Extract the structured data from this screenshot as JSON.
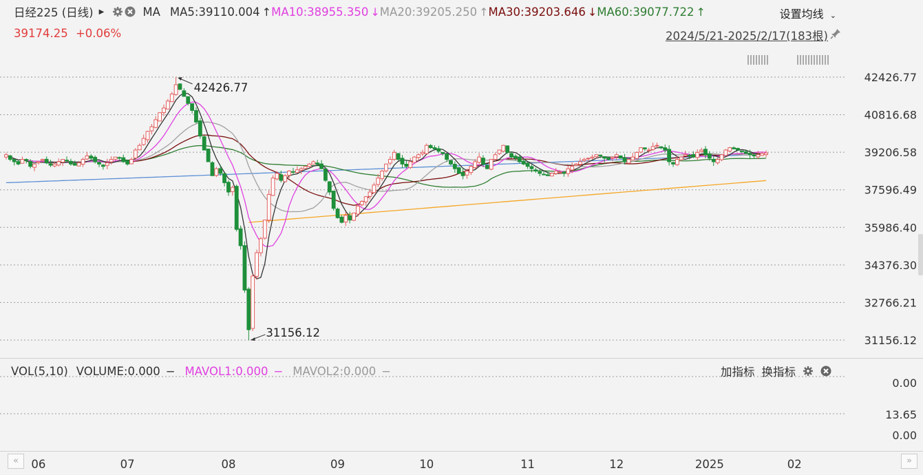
{
  "header": {
    "instrument": "日经225 (日线)",
    "ma_label": "MA",
    "ma_items": [
      {
        "text": "MA5:39110.004",
        "arrow": "↑",
        "color": "#333333"
      },
      {
        "text": "MA10:38955.350",
        "arrow": "↓",
        "color": "#e040e0"
      },
      {
        "text": "MA20:39205.250",
        "arrow": "↑",
        "color": "#999999"
      },
      {
        "text": "MA30:39203.646",
        "arrow": "↓",
        "color": "#7a0e0e"
      },
      {
        "text": "MA60:39077.722",
        "arrow": "↑",
        "color": "#2e7d32"
      }
    ],
    "settings_label": "设置均线",
    "price": "39174.25",
    "change": "+0.06%",
    "range": "2024/5/21-2025/2/17(183根)"
  },
  "volume_panel": {
    "label": "VOL(5,10)",
    "items": [
      {
        "text": "VOLUME:0.000",
        "color": "#333333"
      },
      {
        "text": "MAVOL1:0.000",
        "color": "#e040e0"
      },
      {
        "text": "MAVOL2:0.000",
        "color": "#999999"
      }
    ],
    "add_indicator": "加指标",
    "switch_indicator": "换指标",
    "y_ticks": [
      "0.00",
      "13.65",
      "0.00"
    ]
  },
  "chart_data": {
    "type": "candlestick",
    "title": "日经225 (日线)",
    "price_ticks": [
      42426.77,
      40816.68,
      39206.58,
      37596.49,
      35986.4,
      34376.3,
      32766.21,
      31156.12
    ],
    "y_range": [
      31156.12,
      42426.77
    ],
    "high_label": "42426.77",
    "low_label": "31156.12",
    "x_labels": [
      "06",
      "07",
      "08",
      "09",
      "10",
      "11",
      "12",
      "2025",
      "02"
    ],
    "x_label_days": [
      8,
      30,
      55,
      82,
      104,
      129,
      151,
      174,
      195
    ],
    "days": 205,
    "high_day": 42,
    "low_day": 60,
    "series_colors": {
      "up": "#e35c5c",
      "down": "#1e8f3a",
      "ma5": "#333333",
      "ma10": "#e040e0",
      "ma20": "#a0a0a0",
      "ma30": "#7a0e0e",
      "ma60": "#2e7d32",
      "ma120": "#f5a623",
      "ma250": "#5b8fd6"
    },
    "closes": [
      39100,
      38900,
      38800,
      38700,
      38900,
      38850,
      38600,
      38700,
      38800,
      38900,
      38750,
      38650,
      38700,
      38800,
      38900,
      38850,
      38700,
      38650,
      38750,
      38900,
      39050,
      38950,
      38800,
      38700,
      38600,
      38750,
      38900,
      39000,
      38950,
      38800,
      38700,
      38900,
      39300,
      39500,
      39800,
      40100,
      40300,
      40600,
      40900,
      41100,
      41400,
      41700,
      42100,
      41900,
      41600,
      41300,
      41000,
      40500,
      39900,
      39300,
      38800,
      38200,
      38500,
      38300,
      37900,
      37500,
      37700,
      35900,
      35200,
      33300,
      31600,
      33900,
      34900,
      35500,
      36300,
      37400,
      38100,
      38300,
      38000,
      38200,
      38400,
      38350,
      38450,
      38500,
      38600,
      38700,
      38800,
      38700,
      38500,
      38000,
      37500,
      36800,
      36400,
      36200,
      36500,
      36300,
      36600,
      36900,
      37100,
      37300,
      37500,
      37800,
      38100,
      38400,
      38700,
      38900,
      39200,
      38900,
      38700,
      38600,
      38800,
      39000,
      39100,
      39200,
      39500,
      39400,
      39350,
      39250,
      39150,
      38900,
      38700,
      38500,
      38300,
      38200,
      38400,
      38600,
      38800,
      39000,
      38700,
      38500,
      38900,
      39100,
      39300,
      39500,
      39200,
      39000,
      38950,
      38800,
      38700,
      38600,
      38500,
      38400,
      38300,
      38250,
      38200,
      38300,
      38400,
      38350,
      38300,
      38500,
      38600,
      38700,
      38800,
      38900,
      38950,
      39000,
      39100,
      39050,
      38950,
      38900,
      39000,
      39100,
      38950,
      38800,
      38900,
      39000,
      39200,
      39400,
      39350,
      39300,
      39450,
      39500,
      39400,
      39300,
      38800,
      38700,
      38900,
      39000,
      39100,
      39050,
      39000,
      39200,
      39300,
      39100,
      38950,
      38800,
      38900,
      39100,
      39300,
      39400,
      39350,
      39300,
      39250,
      39150,
      39100,
      39050,
      39100,
      39150,
      39174
    ]
  }
}
